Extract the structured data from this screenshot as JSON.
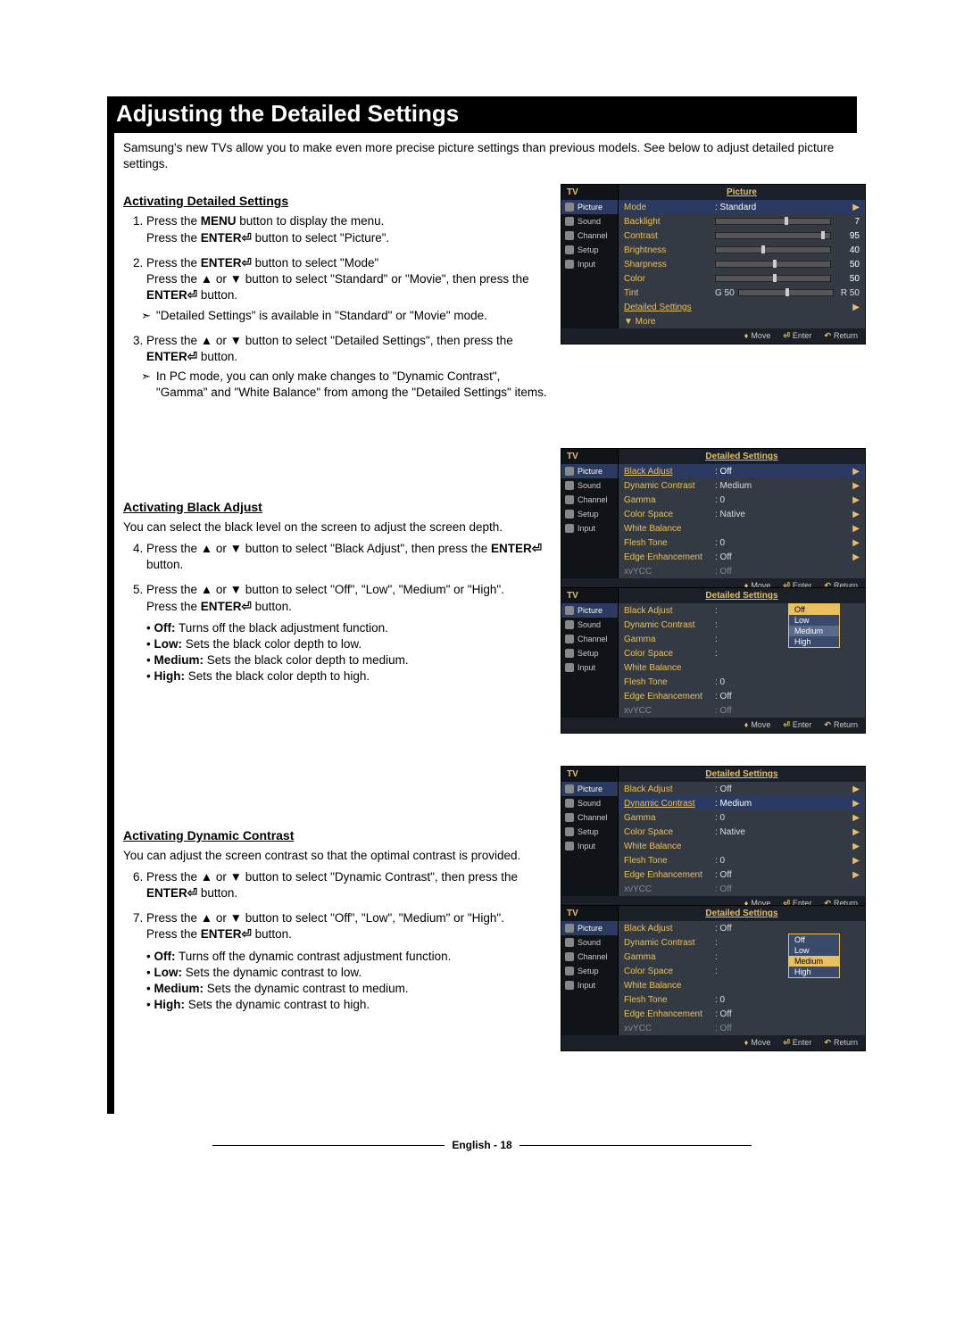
{
  "title": "Adjusting the Detailed Settings",
  "intro": "Samsung's new TVs allow you to make even more precise picture settings than previous models. See below to adjust detailed picture settings.",
  "sections": {
    "a": {
      "heading": "Activating Detailed Settings",
      "steps": {
        "s1a": "Press the ",
        "s1b": " button to display the menu.",
        "s1c": "Press the ",
        "s1d": " button to select \"Picture\".",
        "s2a": "Press the ",
        "s2b": " button to select \"Mode\"",
        "s2c": "Press the ▲ or ▼ button to select \"Standard\" or \"Movie\", then press the ",
        "s2d": " button.",
        "note1": "\"Detailed Settings\" is available in \"Standard\" or \"Movie\" mode.",
        "s3a": "Press the ▲ or ▼ button to select \"Detailed Settings\", then press the ",
        "s3b": " button.",
        "note2": "In PC mode, you can only make changes to \"Dynamic Contrast\", \"Gamma\" and \"White Balance\" from among the \"Detailed Settings\" items."
      }
    },
    "b": {
      "heading": "Activating Black Adjust",
      "intro": "You can select the black level on the screen to adjust the screen depth.",
      "steps": {
        "s4a": "Press the ▲ or ▼ button to select \"Black Adjust\", then press the ",
        "s4b": " button.",
        "s5a": "Press the ▲ or ▼ button to select \"Off\", \"Low\", \"Medium\" or \"High\".",
        "s5b": "Press the ",
        "s5c": " button."
      },
      "bullets": {
        "b1a": "Off:",
        "b1b": " Turns off the black adjustment function.",
        "b2a": "Low:",
        "b2b": " Sets the black color depth to low.",
        "b3a": "Medium:",
        "b3b": " Sets the black color depth to medium.",
        "b4a": "High:",
        "b4b": " Sets the black color depth to high."
      }
    },
    "c": {
      "heading": "Activating Dynamic Contrast",
      "intro": "You can adjust the screen contrast so that the optimal contrast is provided.",
      "steps": {
        "s6a": "Press the ▲ or ▼ button to select \"Dynamic Contrast\", then press the ",
        "s6b": " button.",
        "s7a": "Press the ▲ or ▼ button to select \"Off\", \"Low\", \"Medium\" or \"High\".",
        "s7b": "Press the ",
        "s7c": " button."
      },
      "bullets": {
        "b1a": "Off:",
        "b1b": " Turns off the dynamic contrast adjustment function.",
        "b2a": "Low:",
        "b2b": " Sets the dynamic contrast to low.",
        "b3a": "Medium:",
        "b3b": " Sets the dynamic contrast to medium.",
        "b4a": "High:",
        "b4b": " Sets the dynamic contrast to high."
      }
    }
  },
  "kw": {
    "menu": "MENU",
    "enter": "ENTER⏎"
  },
  "osd": {
    "tv": "TV",
    "side": [
      "Picture",
      "Sound",
      "Channel",
      "Setup",
      "Input"
    ],
    "foot_move": "Move",
    "foot_enter": "Enter",
    "foot_return": "Return",
    "p1": {
      "title": "Picture",
      "rows": {
        "mode_l": "Mode",
        "mode_v": ": Standard",
        "backlight": "Backlight",
        "backlight_v": "7",
        "contrast": "Contrast",
        "contrast_v": "95",
        "brightness": "Brightness",
        "brightness_v": "40",
        "sharpness": "Sharpness",
        "sharpness_v": "50",
        "color": "Color",
        "color_v": "50",
        "tint": "Tint",
        "tint_g": "G 50",
        "tint_r": "R 50",
        "detailed": "Detailed Settings",
        "more": "▼ More"
      }
    },
    "ds": {
      "title": "Detailed Settings",
      "rows": {
        "black": "Black Adjust",
        "black_v": ": Off",
        "dyn": "Dynamic Contrast",
        "dyn_v": ": Medium",
        "gamma": "Gamma",
        "gamma_v": ": 0",
        "cs": "Color Space",
        "cs_v": ": Native",
        "wb": "White Balance",
        "ft": "Flesh Tone",
        "ft_v": ": 0",
        "ee": "Edge Enhancement",
        "ee_v": ": Off",
        "xv": "xvYCC",
        "xv_v": ": Off"
      }
    },
    "popup": {
      "off": "Off",
      "low": "Low",
      "medium": "Medium",
      "high": "High"
    }
  },
  "footer": "English - 18"
}
